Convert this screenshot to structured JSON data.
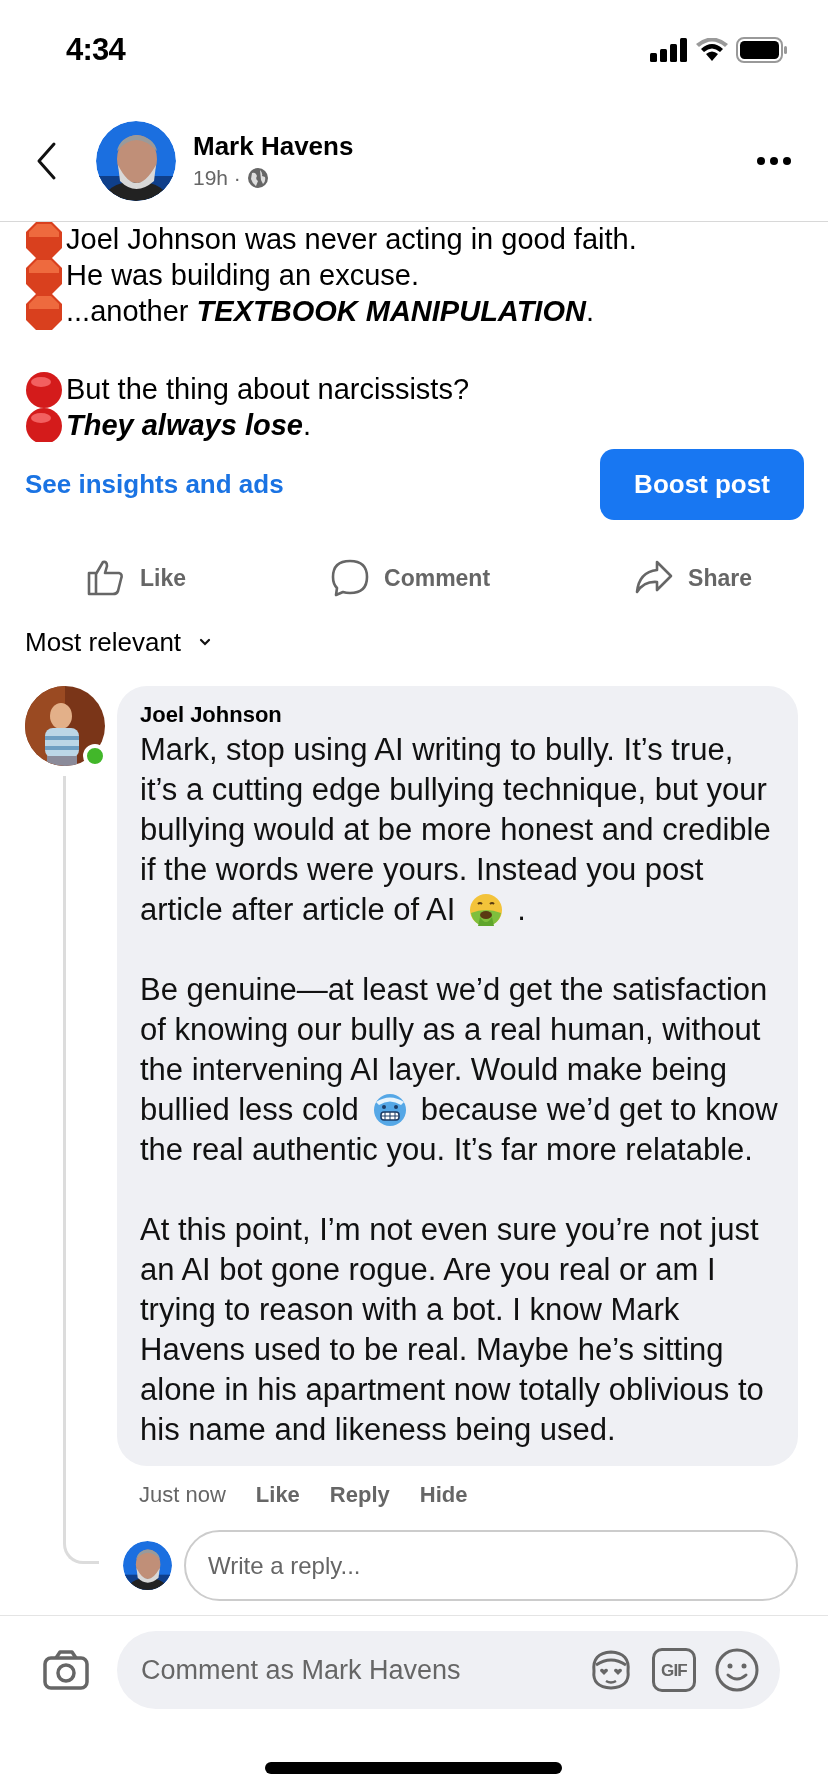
{
  "status_bar": {
    "time": "4:34"
  },
  "header": {
    "name": "Mark Havens",
    "time": "19h ·"
  },
  "post": {
    "paragraphs": [
      {
        "lines": [
          {
            "kind": "octagon",
            "text": "Joel Johnson was never acting in good faith."
          },
          {
            "kind": "octagon",
            "text": "He was building an excuse."
          },
          {
            "kind": "octagon",
            "text": "...another **TEXTBOOK MANIPULATION**."
          }
        ]
      },
      {
        "lines": [
          {
            "kind": "circle",
            "text": "But the thing about narcissists?"
          },
          {
            "kind": "circle",
            "text": "**They always lose**."
          }
        ]
      }
    ]
  },
  "insights_link": "See insights and ads",
  "boost_button": "Boost post",
  "actions": [
    {
      "kind": "like",
      "label": "Like"
    },
    {
      "kind": "comment",
      "label": "Comment"
    },
    {
      "kind": "share",
      "label": "Share"
    }
  ],
  "sort": {
    "label": "Most relevant"
  },
  "comment": {
    "author": "Joel Johnson",
    "online": true,
    "paragraphs": [
      {
        "lines": [
          [
            {
              "kind": "text",
              "text": "Mark, stop using AI writing to bully. It’s true,"
            }
          ],
          [
            {
              "kind": "text",
              "text": "it’s a cutting edge bullying technique, but your"
            }
          ],
          [
            {
              "kind": "text",
              "text": "bullying would at be more honest and credible"
            }
          ],
          [
            {
              "kind": "text",
              "text": "if the words were yours. Instead you post"
            }
          ],
          [
            {
              "kind": "text",
              "text": "article after article of AI"
            },
            {
              "kind": "nauseated-emoji"
            },
            {
              "kind": "text",
              "text": "."
            }
          ]
        ]
      },
      {
        "lines": [
          [
            {
              "kind": "text",
              "text": "Be genuine—at least we’d get the satisfaction"
            }
          ],
          [
            {
              "kind": "text",
              "text": "of knowing our bully as a real human, without"
            }
          ],
          [
            {
              "kind": "text",
              "text": "the intervening AI layer. Would make being"
            }
          ],
          [
            {
              "kind": "text",
              "text": "bullied less cold"
            },
            {
              "kind": "cold-emoji"
            },
            {
              "kind": "text",
              "text": "because we’d get to know"
            }
          ],
          [
            {
              "kind": "text",
              "text": "the real authentic you. It’s far more relatable."
            }
          ]
        ]
      },
      {
        "lines": [
          [
            {
              "kind": "text",
              "text": "At this point, I’m not even sure you’re not just"
            }
          ],
          [
            {
              "kind": "text",
              "text": "an AI bot gone rogue. Are you real or am I"
            }
          ],
          [
            {
              "kind": "text",
              "text": "trying to reason with a bot. I know Mark"
            }
          ],
          [
            {
              "kind": "text",
              "text": "Havens used to be real. Maybe he’s sitting"
            }
          ],
          [
            {
              "kind": "text",
              "text": "alone in his apartment now totally oblivious to"
            }
          ],
          [
            {
              "kind": "text",
              "text": "his name and likeness being used."
            }
          ]
        ]
      }
    ],
    "time": "Just now",
    "actions": [
      "Like",
      "Reply",
      "Hide"
    ]
  },
  "reply_field": {
    "placeholder": "Write a reply..."
  },
  "composer": {
    "placeholder": "Comment as Mark Havens",
    "tools": [
      {
        "kind": "sticker"
      },
      {
        "kind": "gif",
        "label": "GIF"
      },
      {
        "kind": "emoji"
      }
    ]
  }
}
